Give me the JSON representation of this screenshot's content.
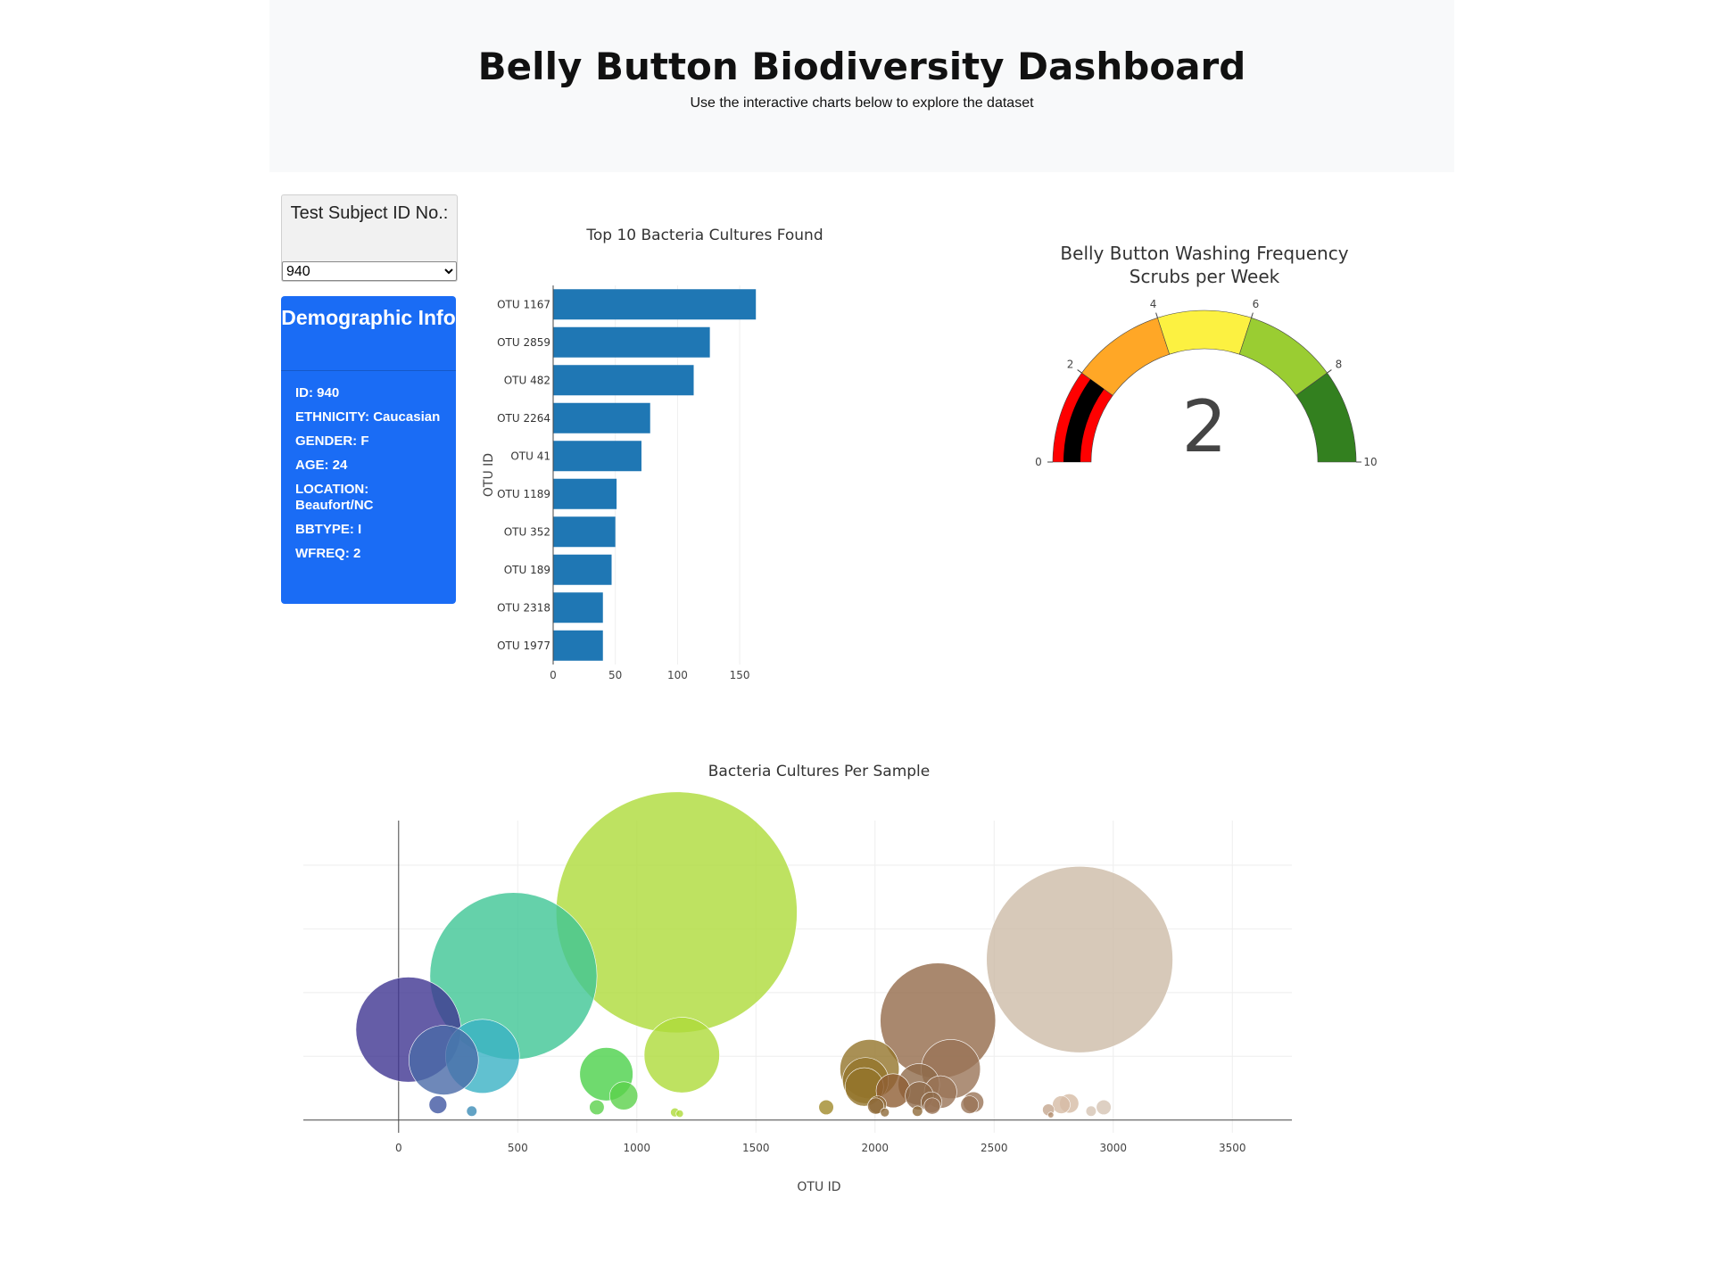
{
  "header": {
    "title": "Belly Button Biodiversity Dashboard",
    "subtitle": "Use the interactive charts below to explore the dataset"
  },
  "selector": {
    "label": "Test Subject ID No.:",
    "selected": "940"
  },
  "demographics": {
    "title": "Demographic Info",
    "items": [
      "ID: 940",
      "ETHNICITY: Caucasian",
      "GENDER: F",
      "AGE: 24",
      "LOCATION: Beaufort/NC",
      "BBTYPE: I",
      "WFREQ: 2"
    ]
  },
  "chart_data": [
    {
      "type": "bar",
      "orientation": "horizontal",
      "title": "Top 10 Bacteria Cultures Found",
      "ylabel": "OTU ID",
      "xlabel": "",
      "categories": [
        "OTU 1167",
        "OTU 2859",
        "OTU 482",
        "OTU 2264",
        "OTU 41",
        "OTU 1189",
        "OTU 352",
        "OTU 189",
        "OTU 2318",
        "OTU 1977"
      ],
      "values": [
        163,
        126,
        113,
        78,
        71,
        51,
        50,
        47,
        40,
        40
      ],
      "xlim": [
        0,
        165
      ],
      "xticks": [
        0,
        50,
        100,
        150
      ],
      "color": "#1f77b4",
      "grid": true
    },
    {
      "type": "gauge",
      "title": "Belly Button Washing Frequency",
      "subtitle": "Scrubs per Week",
      "value": 2,
      "range": [
        0,
        10
      ],
      "ticks": [
        0,
        2,
        4,
        6,
        8,
        10
      ],
      "steps": [
        {
          "range": [
            0,
            2
          ],
          "color": "#ff0000"
        },
        {
          "range": [
            2,
            4
          ],
          "color": "#ffa726"
        },
        {
          "range": [
            4,
            6
          ],
          "color": "#fcf141"
        },
        {
          "range": [
            6,
            8
          ],
          "color": "#9acd32"
        },
        {
          "range": [
            8,
            10
          ],
          "color": "#33801f"
        }
      ],
      "bar_color": "#000000"
    },
    {
      "type": "scatter",
      "marker": "bubble",
      "title": "Bacteria Cultures Per Sample",
      "xlabel": "OTU ID",
      "ylabel": "",
      "xlim": [
        -400,
        3750
      ],
      "ylim": [
        -10,
        235
      ],
      "xticks": [
        0,
        500,
        1000,
        1500,
        2000,
        2500,
        3000,
        3500
      ],
      "yticks": [
        0,
        50,
        100,
        150,
        200
      ],
      "grid": true,
      "points": [
        {
          "x": 41,
          "y": 71,
          "color": "#3f3591"
        },
        {
          "x": 189,
          "y": 47,
          "color": "#4a6aa8"
        },
        {
          "x": 352,
          "y": 50,
          "color": "#3ab2c4"
        },
        {
          "x": 482,
          "y": 113,
          "color": "#3ec695"
        },
        {
          "x": 1167,
          "y": 163,
          "color": "#aedb3a"
        },
        {
          "x": 1189,
          "y": 51,
          "color": "#aedb3a"
        },
        {
          "x": 872,
          "y": 36,
          "color": "#4bd14a"
        },
        {
          "x": 945,
          "y": 19,
          "color": "#5bd14b"
        },
        {
          "x": 832,
          "y": 10,
          "color": "#5bd14b"
        },
        {
          "x": 165,
          "y": 12,
          "color": "#4056a1"
        },
        {
          "x": 307,
          "y": 7,
          "color": "#3c8cb6"
        },
        {
          "x": 1795,
          "y": 10,
          "color": "#a08a2a"
        },
        {
          "x": 1977,
          "y": 40,
          "color": "#93742b"
        },
        {
          "x": 1960,
          "y": 31,
          "color": "#93742b"
        },
        {
          "x": 1955,
          "y": 26,
          "color": "#93742b"
        },
        {
          "x": 2011,
          "y": 12,
          "color": "#8e6a3a"
        },
        {
          "x": 2003,
          "y": 11,
          "color": "#8e6a3a"
        },
        {
          "x": 2076,
          "y": 23,
          "color": "#8e5e33"
        },
        {
          "x": 2184,
          "y": 28,
          "color": "#8e6a4a"
        },
        {
          "x": 2186,
          "y": 19,
          "color": "#8e6a4a"
        },
        {
          "x": 2237,
          "y": 14,
          "color": "#8e6a4a"
        },
        {
          "x": 2264,
          "y": 78,
          "color": "#946a4a"
        },
        {
          "x": 2275,
          "y": 22,
          "color": "#9a7457"
        },
        {
          "x": 2240,
          "y": 11,
          "color": "#9a7457"
        },
        {
          "x": 2318,
          "y": 40,
          "color": "#9a7457"
        },
        {
          "x": 2413,
          "y": 14,
          "color": "#9a7457"
        },
        {
          "x": 2397,
          "y": 12,
          "color": "#9a7457"
        },
        {
          "x": 2859,
          "y": 126,
          "color": "#cdbba8"
        },
        {
          "x": 2815,
          "y": 13,
          "color": "#d6bca5"
        },
        {
          "x": 2782,
          "y": 12,
          "color": "#d6bca5"
        },
        {
          "x": 2728,
          "y": 8,
          "color": "#c4a68f"
        },
        {
          "x": 2960,
          "y": 10,
          "color": "#d6c4b4"
        },
        {
          "x": 2907,
          "y": 7,
          "color": "#d6c4b4"
        },
        {
          "x": 2738,
          "y": 4,
          "color": "#b38d6e"
        },
        {
          "x": 1160,
          "y": 6,
          "color": "#aedb3a"
        },
        {
          "x": 1180,
          "y": 5,
          "color": "#aedb3a"
        },
        {
          "x": 2041,
          "y": 6,
          "color": "#8e6a3a"
        },
        {
          "x": 2178,
          "y": 7,
          "color": "#8e6a3a"
        }
      ]
    }
  ]
}
